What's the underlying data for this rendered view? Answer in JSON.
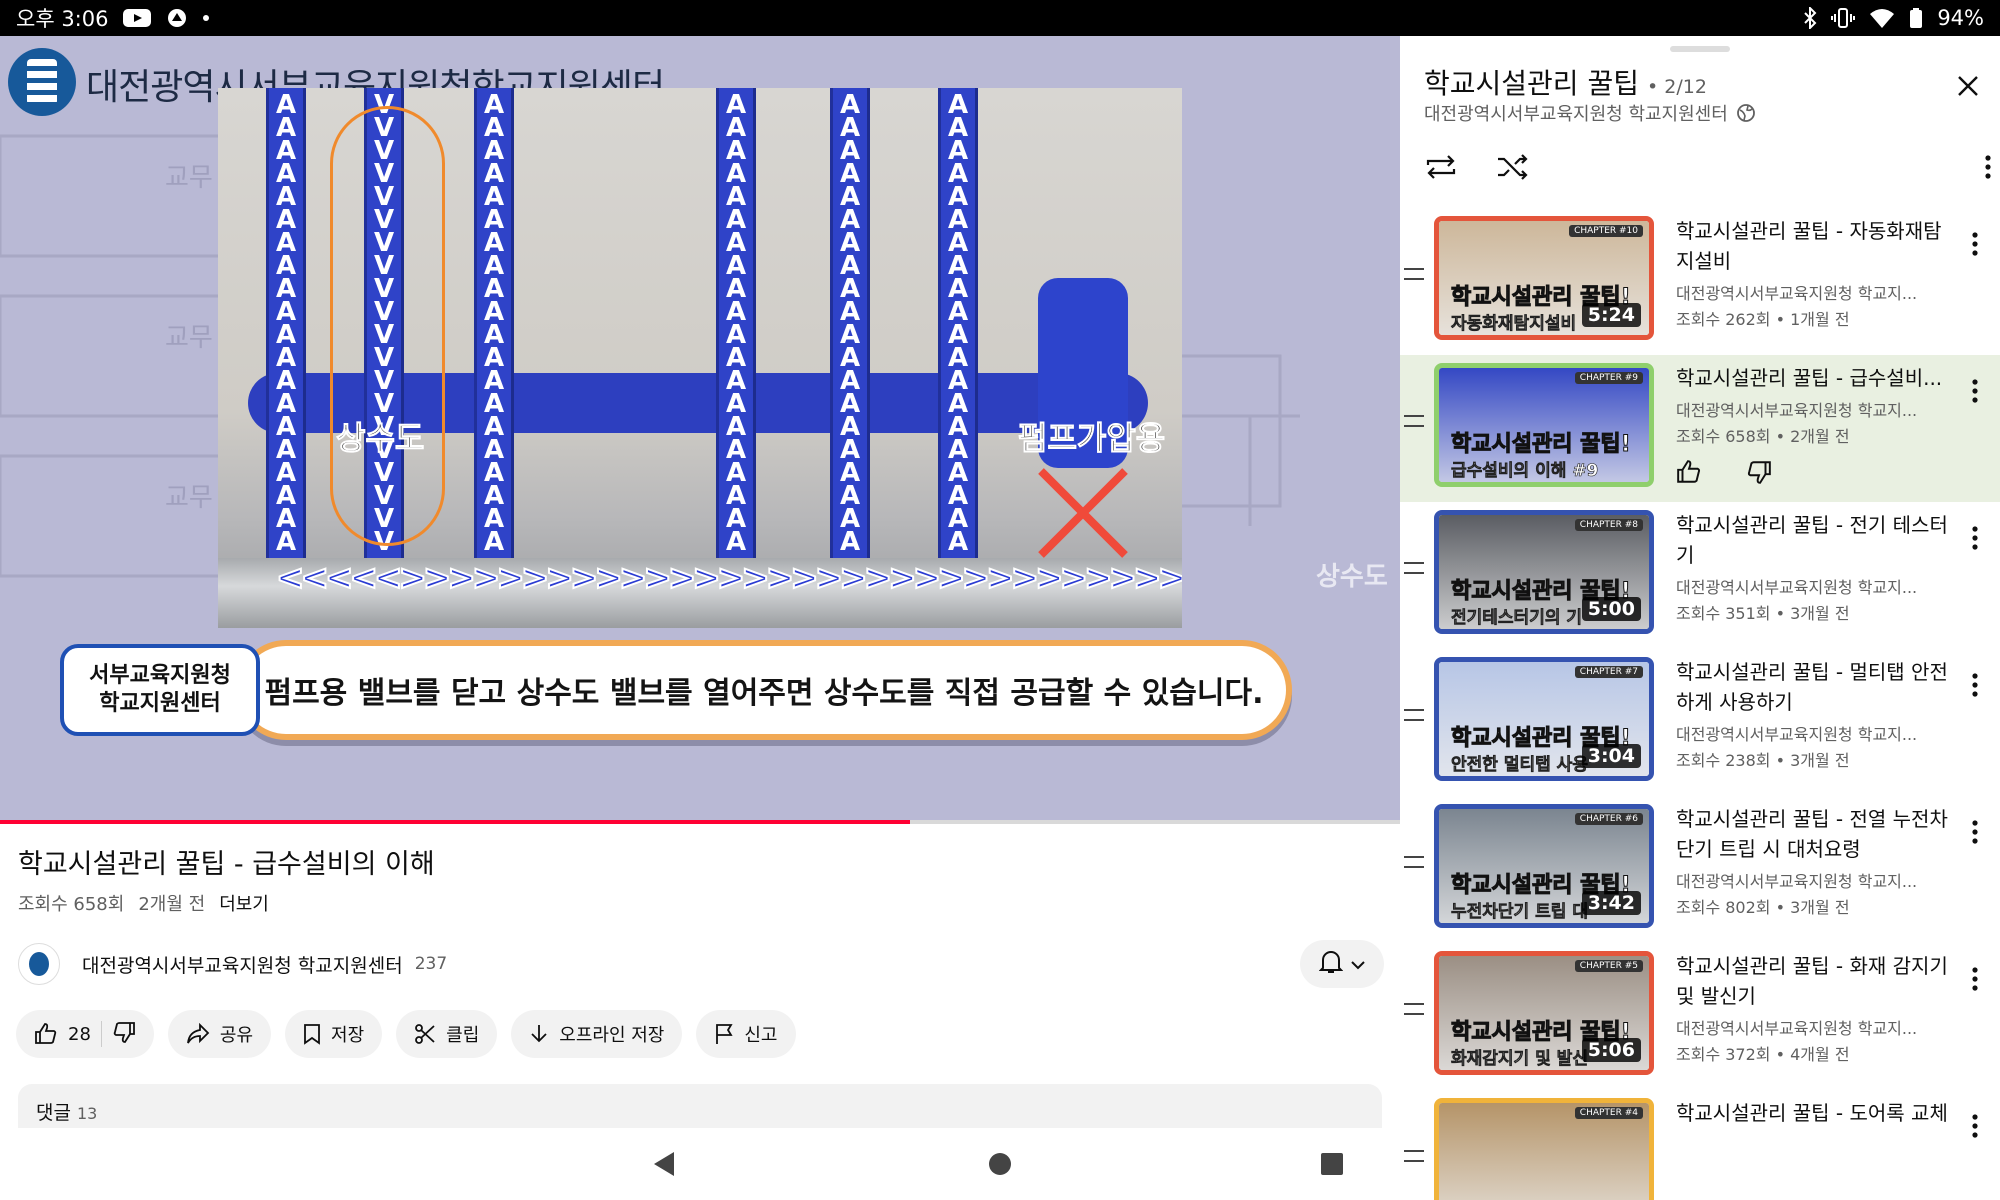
{
  "status_bar": {
    "time": "오후 3:06",
    "battery": "94%"
  },
  "player": {
    "org_title": "대전광역시서부교육지원청학교지원센터",
    "label_water": "상수도",
    "label_pump": "펌프가압용",
    "side_label": "상수도",
    "caption_badge_line1": "서부교육지원청",
    "caption_badge_line2": "학교지원센터",
    "caption_text": "펌프용 밸브를 닫고 상수도 밸브를 열어주면 상수도를 직접 공급할 수 있습니다.",
    "progress_fraction": 0.65
  },
  "video": {
    "title": "학교시설관리 꿀팁 - 급수설비의 이해",
    "views": "조회수 658회",
    "age": "2개월 전",
    "more": "더보기",
    "channel_name": "대전광역시서부교육지원청 학교지원센터",
    "subscribers": "237",
    "likes": "28",
    "actions": {
      "share": "공유",
      "save": "저장",
      "clip": "클립",
      "download": "오프라인 저장",
      "report": "신고"
    },
    "comments_label": "댓글",
    "comments_count": "13"
  },
  "playlist": {
    "title": "학교시설관리 꿀팁",
    "position": "2/12",
    "owner": "대전광역시서부교육지원청 학교지원센터",
    "items": [
      {
        "title": "학교시설관리 꿀팁 - 자동화재탐지설비",
        "channel": "대전광역시서부교육지원청 학교지...",
        "meta": "조회수 262회 • 1개월 전",
        "duration": "5:24",
        "chapter": "CHAPTER #10",
        "thumb_headline": "학교시설관리 꿀팁!",
        "thumb_sub": "자동화재탐지설비",
        "frame": "#e4553b",
        "bg": "#cdb79a"
      },
      {
        "title": "학교시설관리 꿀팁 - 급수설비...",
        "channel": "대전광역시서부교육지원청 학교지...",
        "meta": "조회수 658회 • 2개월 전",
        "duration": "",
        "chapter": "CHAPTER #9",
        "thumb_headline": "학교시설관리 꿀팁!",
        "thumb_sub": "급수설비의 이해 #9",
        "frame": "#8fcf6c",
        "bg": "#3448c4"
      },
      {
        "title": "학교시설관리 꿀팁 - 전기 테스터기",
        "channel": "대전광역시서부교육지원청 학교지...",
        "meta": "조회수 351회 • 3개월 전",
        "duration": "5:00",
        "chapter": "CHAPTER #8",
        "thumb_headline": "학교시설관리 꿀팁!",
        "thumb_sub": "전기테스터기의 기",
        "frame": "#3553b0",
        "bg": "#5a5d63"
      },
      {
        "title": "학교시설관리 꿀팁 - 멀티탭 안전하게 사용하기",
        "channel": "대전광역시서부교육지원청 학교지...",
        "meta": "조회수 238회 • 3개월 전",
        "duration": "3:04",
        "chapter": "CHAPTER #7",
        "thumb_headline": "학교시설관리 꿀팁!",
        "thumb_sub": "안전한 멀티탭 사용",
        "frame": "#3553b0",
        "bg": "#b7c6e6"
      },
      {
        "title": "학교시설관리 꿀팁 - 전열 누전차단기 트립 시 대처요령",
        "channel": "대전광역시서부교육지원청 학교지...",
        "meta": "조회수 802회 • 3개월 전",
        "duration": "3:42",
        "chapter": "CHAPTER #6",
        "thumb_headline": "학교시설관리 꿀팁!",
        "thumb_sub": "누전차단기 트립 대",
        "frame": "#3553b0",
        "bg": "#7b8590"
      },
      {
        "title": "학교시설관리 꿀팁 - 화재 감지기 및 발신기",
        "channel": "대전광역시서부교육지원청 학교지...",
        "meta": "조회수 372회 • 4개월 전",
        "duration": "5:06",
        "chapter": "CHAPTER #5",
        "thumb_headline": "학교시설관리 꿀팁!",
        "thumb_sub": "화재감지기 및 발신",
        "frame": "#e4553b",
        "bg": "#9b8f84"
      },
      {
        "title": "학교시설관리 꿀팁 - 도어록 교체",
        "channel": "",
        "meta": "",
        "duration": "",
        "chapter": "CHAPTER #4",
        "thumb_headline": "",
        "thumb_sub": "",
        "frame": "#f0b33a",
        "bg": "#b59468"
      }
    ]
  }
}
